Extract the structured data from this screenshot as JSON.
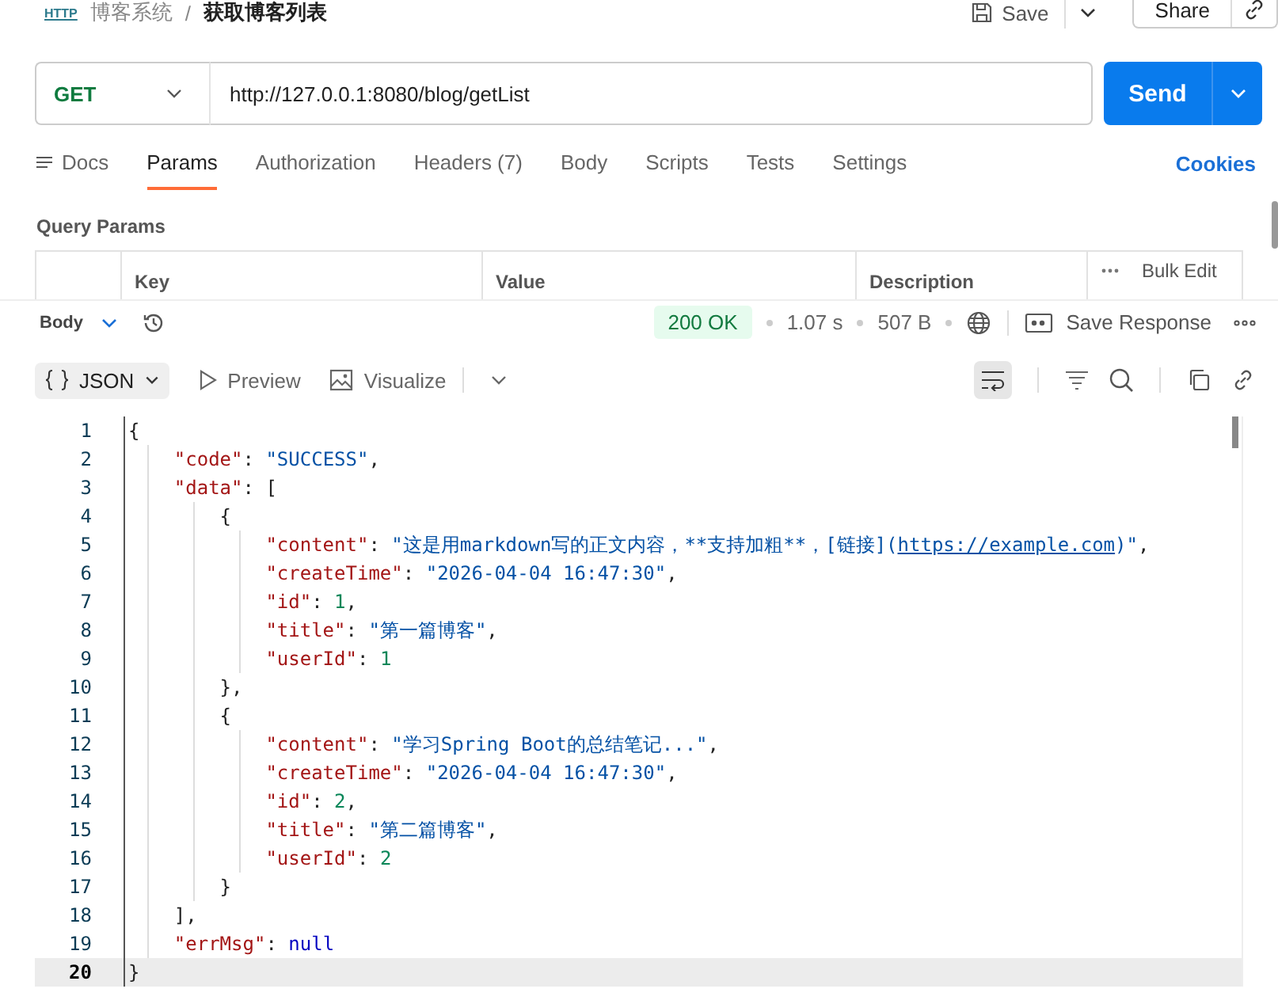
{
  "breadcrumb": {
    "icon_text": "HTTP",
    "collection": "博客系统",
    "separator": "/",
    "request": "获取博客列表"
  },
  "header_actions": {
    "save": "Save",
    "share": "Share"
  },
  "request": {
    "method": "GET",
    "url": "http://127.0.0.1:8080/blog/getList",
    "send": "Send"
  },
  "tabs": [
    {
      "label": "Docs",
      "selected": false,
      "kind": "docs"
    },
    {
      "label": "Params",
      "selected": true
    },
    {
      "label": "Authorization",
      "selected": false
    },
    {
      "label": "Headers (7)",
      "selected": false
    },
    {
      "label": "Body",
      "selected": false
    },
    {
      "label": "Scripts",
      "selected": false
    },
    {
      "label": "Tests",
      "selected": false
    },
    {
      "label": "Settings",
      "selected": false
    }
  ],
  "cookies": "Cookies",
  "query_params": {
    "title": "Query Params",
    "columns": [
      "Key",
      "Value",
      "Description"
    ],
    "bulk_edit": "Bulk Edit"
  },
  "response_bar": {
    "section": "Body",
    "status": "200 OK",
    "time": "1.07 s",
    "size": "507 B",
    "save_response": "Save Response"
  },
  "response_toolbar": {
    "format": "JSON",
    "preview": "Preview",
    "visualize": "Visualize"
  },
  "code": {
    "lines": [
      {
        "number": "1",
        "selected": false,
        "tokens": [
          {
            "kind": "punct",
            "text": "{"
          }
        ]
      },
      {
        "number": "2",
        "selected": false,
        "tokens": [
          {
            "kind": "key",
            "text": "\"code\""
          },
          {
            "kind": "punct",
            "text": ": "
          },
          {
            "kind": "string",
            "text": "\"SUCCESS\""
          },
          {
            "kind": "punct",
            "text": ","
          }
        ]
      },
      {
        "number": "3",
        "selected": false,
        "tokens": [
          {
            "kind": "key",
            "text": "\"data\""
          },
          {
            "kind": "punct",
            "text": ": ["
          }
        ]
      },
      {
        "number": "4",
        "selected": false,
        "tokens": [
          {
            "kind": "punct",
            "text": "{"
          }
        ]
      },
      {
        "number": "5",
        "selected": false,
        "tokens": [
          {
            "kind": "key",
            "text": "\"content\""
          },
          {
            "kind": "punct",
            "text": ": "
          },
          {
            "kind": "string",
            "text": "\"这是用markdown写的正文内容，**支持加粗**，[链接]("
          },
          {
            "kind": "link",
            "text": "https://example.com"
          },
          {
            "kind": "string",
            "text": ")\""
          },
          {
            "kind": "punct",
            "text": ","
          }
        ]
      },
      {
        "number": "6",
        "selected": false,
        "tokens": [
          {
            "kind": "key",
            "text": "\"createTime\""
          },
          {
            "kind": "punct",
            "text": ": "
          },
          {
            "kind": "string",
            "text": "\"2026-04-04 16:47:30\""
          },
          {
            "kind": "punct",
            "text": ","
          }
        ]
      },
      {
        "number": "7",
        "selected": false,
        "tokens": [
          {
            "kind": "key",
            "text": "\"id\""
          },
          {
            "kind": "punct",
            "text": ": "
          },
          {
            "kind": "number",
            "text": "1"
          },
          {
            "kind": "punct",
            "text": ","
          }
        ]
      },
      {
        "number": "8",
        "selected": false,
        "tokens": [
          {
            "kind": "key",
            "text": "\"title\""
          },
          {
            "kind": "punct",
            "text": ": "
          },
          {
            "kind": "string",
            "text": "\"第一篇博客\""
          },
          {
            "kind": "punct",
            "text": ","
          }
        ]
      },
      {
        "number": "9",
        "selected": false,
        "tokens": [
          {
            "kind": "key",
            "text": "\"userId\""
          },
          {
            "kind": "punct",
            "text": ": "
          },
          {
            "kind": "number",
            "text": "1"
          }
        ]
      },
      {
        "number": "10",
        "selected": false,
        "tokens": [
          {
            "kind": "punct",
            "text": "},"
          }
        ]
      },
      {
        "number": "11",
        "selected": false,
        "tokens": [
          {
            "kind": "punct",
            "text": "{"
          }
        ]
      },
      {
        "number": "12",
        "selected": false,
        "tokens": [
          {
            "kind": "key",
            "text": "\"content\""
          },
          {
            "kind": "punct",
            "text": ": "
          },
          {
            "kind": "string",
            "text": "\"学习Spring Boot的总结笔记...\""
          },
          {
            "kind": "punct",
            "text": ","
          }
        ]
      },
      {
        "number": "13",
        "selected": false,
        "tokens": [
          {
            "kind": "key",
            "text": "\"createTime\""
          },
          {
            "kind": "punct",
            "text": ": "
          },
          {
            "kind": "string",
            "text": "\"2026-04-04 16:47:30\""
          },
          {
            "kind": "punct",
            "text": ","
          }
        ]
      },
      {
        "number": "14",
        "selected": false,
        "tokens": [
          {
            "kind": "key",
            "text": "\"id\""
          },
          {
            "kind": "punct",
            "text": ": "
          },
          {
            "kind": "number",
            "text": "2"
          },
          {
            "kind": "punct",
            "text": ","
          }
        ]
      },
      {
        "number": "15",
        "selected": false,
        "tokens": [
          {
            "kind": "key",
            "text": "\"title\""
          },
          {
            "kind": "punct",
            "text": ": "
          },
          {
            "kind": "string",
            "text": "\"第二篇博客\""
          },
          {
            "kind": "punct",
            "text": ","
          }
        ]
      },
      {
        "number": "16",
        "selected": false,
        "tokens": [
          {
            "kind": "key",
            "text": "\"userId\""
          },
          {
            "kind": "punct",
            "text": ": "
          },
          {
            "kind": "number",
            "text": "2"
          }
        ]
      },
      {
        "number": "17",
        "selected": false,
        "tokens": [
          {
            "kind": "punct",
            "text": "}"
          }
        ]
      },
      {
        "number": "18",
        "selected": false,
        "tokens": [
          {
            "kind": "punct",
            "text": "],"
          }
        ]
      },
      {
        "number": "19",
        "selected": false,
        "tokens": [
          {
            "kind": "key",
            "text": "\"errMsg\""
          },
          {
            "kind": "punct",
            "text": ": "
          },
          {
            "kind": "null",
            "text": "null"
          }
        ]
      },
      {
        "number": "20",
        "selected": true,
        "tokens": [
          {
            "kind": "punct",
            "text": "}"
          }
        ]
      }
    ]
  }
}
